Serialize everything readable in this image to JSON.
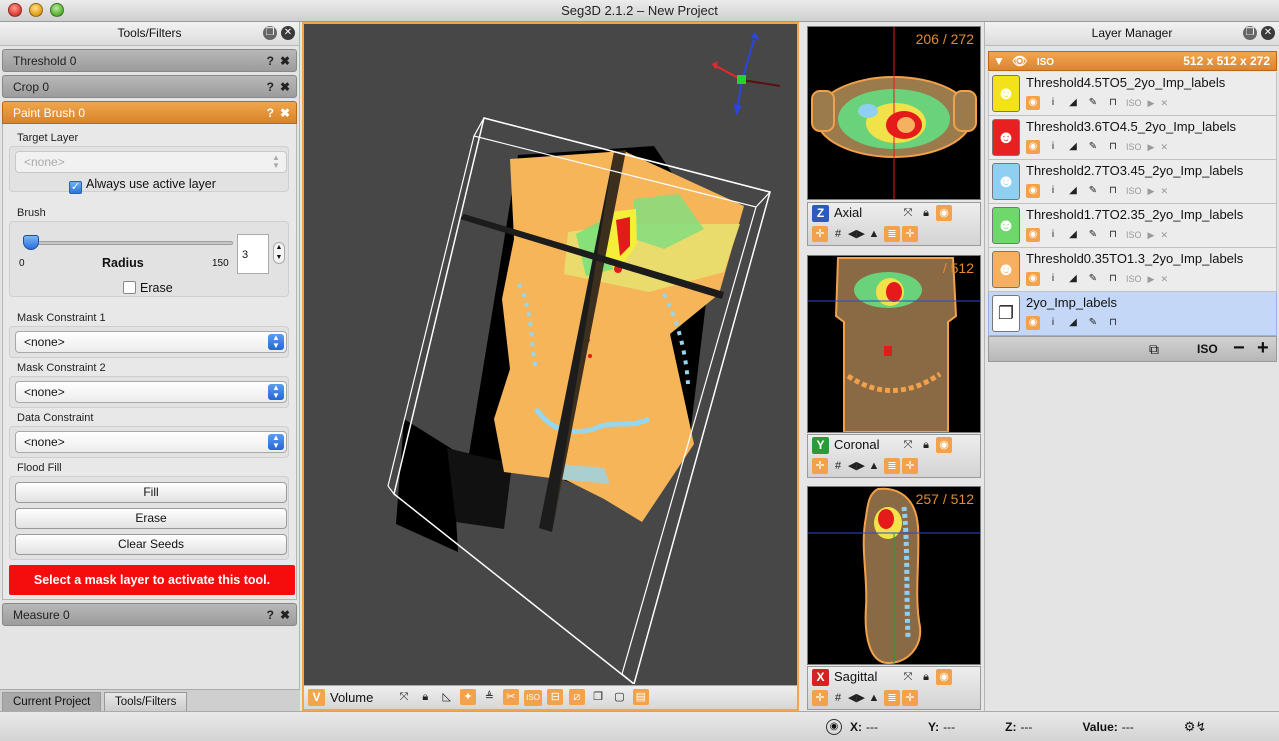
{
  "window": {
    "title": "Seg3D 2.1.2  – New Project"
  },
  "tools_panel": {
    "title": "Tools/Filters",
    "help_glyph": "?",
    "close_glyph": "✖",
    "tools": [
      {
        "name": "Threshold 0"
      },
      {
        "name": "Crop 0"
      },
      {
        "name": "Paint Brush 0"
      },
      {
        "name": "Measure 0"
      }
    ],
    "paint_brush": {
      "target_layer_label": "Target Layer",
      "target_layer_value": "<none>",
      "always_active_label": "Always use active layer",
      "always_active_checked": true,
      "brush_label": "Brush",
      "slider_min": "0",
      "slider_max": "150",
      "slider_label": "Radius",
      "radius_value": "3",
      "erase_label": "Erase",
      "mask1_label": "Mask Constraint 1",
      "mask1_value": "<none>",
      "mask2_label": "Mask Constraint 2",
      "mask2_value": "<none>",
      "data_label": "Data Constraint",
      "data_value": "<none>",
      "flood_label": "Flood Fill",
      "fill_btn": "Fill",
      "erase_btn": "Erase",
      "clear_btn": "Clear Seeds",
      "warning": "Select a mask layer to activate this tool."
    },
    "tabs": [
      "Current Project",
      "Tools/Filters"
    ]
  },
  "view3d": {
    "letter": "V",
    "label": "Volume",
    "iso_label": "ISO"
  },
  "views2d": [
    {
      "letter": "Z",
      "label": "Axial",
      "count": "206 / 272",
      "letter_color": "#2a5bbf"
    },
    {
      "letter": "Y",
      "label": "Coronal",
      "count": "/ 512",
      "letter_color": "#2b9b3a"
    },
    {
      "letter": "X",
      "label": "Sagittal",
      "count": "257 / 512",
      "letter_color": "#d32222"
    }
  ],
  "layer_manager": {
    "title": "Layer Manager",
    "group_iso": "ISO",
    "group_size": "512 x 512 x 272",
    "iso_small": "ISO",
    "layers": [
      {
        "name": "Threshold4.5TO5_2yo_Imp_labels",
        "color": "#f3e21a"
      },
      {
        "name": "Threshold3.6TO4.5_2yo_Imp_labels",
        "color": "#e82020"
      },
      {
        "name": "Threshold2.7TO3.45_2yo_Imp_labels",
        "color": "#8fd0f2"
      },
      {
        "name": "Threshold1.7TO2.35_2yo_Imp_labels",
        "color": "#6fd86a"
      },
      {
        "name": "Threshold0.35TO1.3_2yo_Imp_labels",
        "color": "#f7b062"
      },
      {
        "name": "2yo_Imp_labels",
        "color": "#ffffff"
      }
    ],
    "footer_iso": "ISO"
  },
  "status": {
    "x_label": "X:",
    "x_value": "---",
    "y_label": "Y:",
    "y_value": "---",
    "z_label": "Z:",
    "z_value": "---",
    "v_label": "Value:",
    "v_value": "---"
  }
}
